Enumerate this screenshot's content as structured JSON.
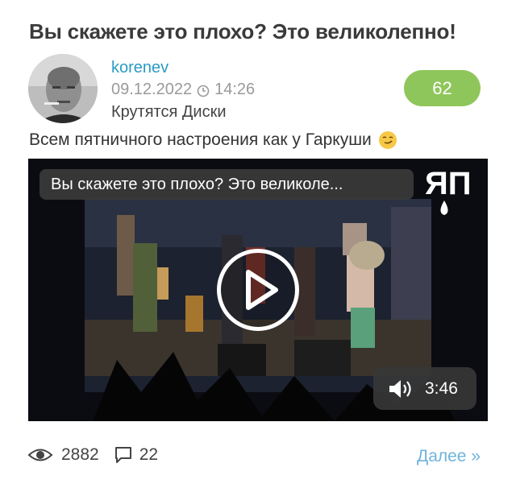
{
  "post": {
    "title": "Вы скажете это плохо? Это великолепно!",
    "author": "korenev",
    "date": "09.12.2022",
    "time": "14:26",
    "channel": "Крутятся Диски",
    "rating": "62",
    "text": "Всем пятничного настроения как у Гаркуши",
    "text_emoji_icon": "smirk-emoji-icon"
  },
  "video": {
    "title": "Вы скажете это плохо? Это великоле...",
    "logo_text": "ЯП",
    "duration": "3:46",
    "play_icon": "play-icon",
    "volume_icon": "volume-icon"
  },
  "footer": {
    "views": "2882",
    "comments": "22",
    "more_label": "Далее »",
    "views_icon": "eye-icon",
    "comments_icon": "comment-icon"
  },
  "colors": {
    "author_link": "#2a9bc4",
    "rating_bg": "#8fc65b",
    "more_link": "#6fb3dc",
    "title_text": "#3a3a3a"
  }
}
